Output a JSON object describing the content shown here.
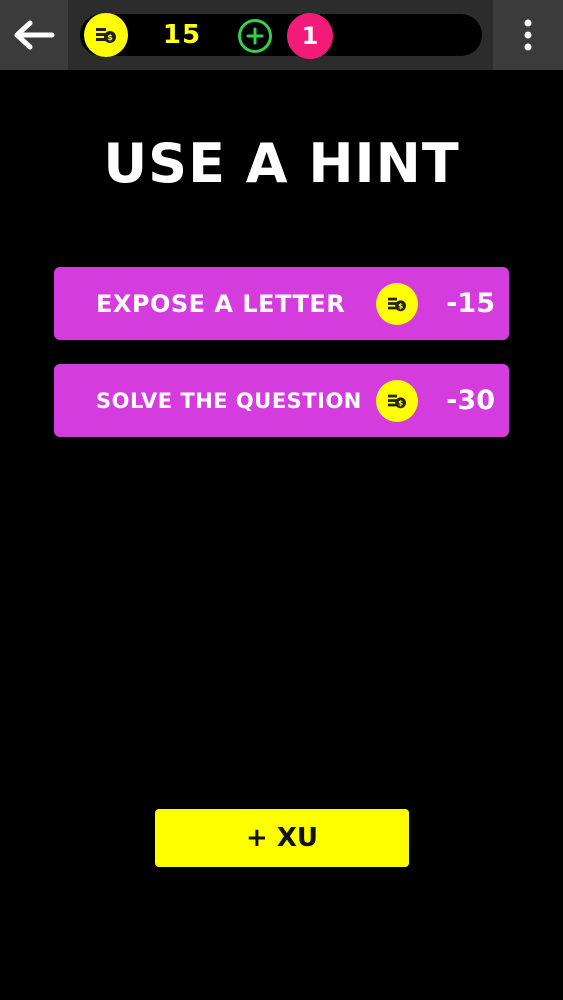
{
  "header": {
    "coins": "15",
    "hints": "1"
  },
  "title": "USE A HINT",
  "options": [
    {
      "label": "EXPOSE A LETTER",
      "cost": "-15"
    },
    {
      "label": "SOLVE THE QUESTION",
      "cost": "-30"
    }
  ],
  "buy_button": "+ XU",
  "icons": {
    "back": "back-arrow-icon",
    "menu": "more-vertical-icon",
    "coin": "coin-stack-icon",
    "add": "plus-circle-icon"
  },
  "colors": {
    "background": "#000000",
    "topbar": "#2c2c2c",
    "coin_yellow": "#ffff00",
    "option_purple": "#d43cde",
    "hint_pink": "#f21b78",
    "add_green": "#2fd24a"
  }
}
